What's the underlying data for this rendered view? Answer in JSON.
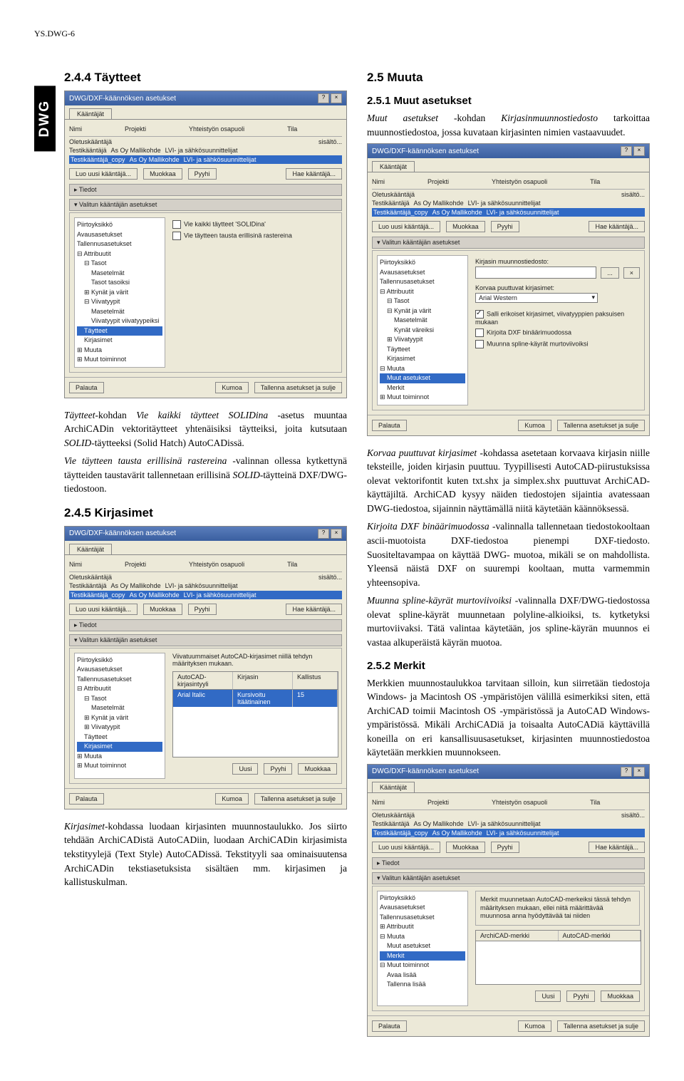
{
  "header_code": "YS.DWG-6",
  "side_tag": "DWG",
  "left": {
    "h1": "2.4.4 Täytteet",
    "p1_html": "<em>Täytteet</em>-kohdan <em>Vie kaikki täytteet SOLIDina</em> -asetus muuntaa ArchiCADin vektoritäytteet yhtenäisiksi täytteiksi, joita kutsutaan <em>SOLID</em>-täytteeksi (Solid Hatch) AutoCADissä.",
    "p2_html": "<em>Vie täytteen tausta erillisinä rastereina</em> -valinnan ollessa kytkettynä täytteiden taustavärit tallennetaan erillisinä <em>SOLID</em>-täytteinä DXF/DWG-tiedostoon.",
    "h2": "2.4.5 Kirjasimet",
    "p3_html": "<em>Kirjasimet</em>-kohdassa luodaan kirjasinten muunnostaulukko. Jos siirto tehdään ArchiCADistä AutoCADiin, luodaan ArchiCADin kirjasimista tekstityylejä (Text Style) AutoCADissä. Tekstityyli saa ominaisuutensa ArchiCADin tekstiasetuksista sisältäen mm. kirjasimen ja kallistuskulman."
  },
  "right": {
    "h1": "2.5 Muuta",
    "h2": "2.5.1 Muut asetukset",
    "p1_html": "<em>Muut asetukset</em> -kohdan <em>Kirjasinmuunnostiedosto</em> tarkoittaa muunnostiedostoa, jossa kuvataan kirjasinten nimien vastaavuudet.",
    "p2_html": "<em>Korvaa puuttuvat kirjasimet</em> -kohdassa asetetaan korvaava kirjasin niille teksteille, joiden kirjasin puuttuu. Tyypillisesti AutoCAD-piirustuksissa olevat vektorifontit kuten txt.shx ja simplex.shx puuttuvat ArchiCAD-käyttäjiltä. ArchiCAD kysyy näiden tiedostojen sijaintia avatessaan DWG-tiedostoa, sijainnin näyttämällä niitä käytetään käännöksessä.",
    "p3_html": "<em>Kirjoita DXF binäärimuodossa</em> -valinnalla tallennetaan tiedostokooltaan ascii-muotoista DXF-tiedostoa pienempi DXF-tiedosto. Suositeltavampaa on käyttää DWG- muotoa, mikäli se on mahdollista. Yleensä näistä DXF on suurempi kooltaan, mutta varmemmin yhteensopiva.",
    "p4_html": "<em>Muunna spline-käyrät murtoviivoiksi</em> -valinnalla DXF/DWG-tiedostossa olevat spline-käyrät muunnetaan polyline-alkioiksi, ts. kytketyksi murtoviivaksi. Tätä valintaa käytetään, jos spline-käyrän muunnos ei vastaa alkuperäistä käyrän muotoa.",
    "h3": "2.5.2 Merkit",
    "p5_html": "Merkkien muunnostaulukkoa tarvitaan silloin, kun siirretään tiedostoja Windows- ja Macintosh OS -ympäristöjen välillä esimerkiksi siten, että ArchiCAD toimii Macintosh OS -ympäristössä ja AutoCAD Windows-ympäristössä. Mikäli ArchiCADiä ja toisaalta AutoCADiä käyttävillä koneilla on eri kansallisuusasetukset, kirjasinten muunnostiedostoa käytetään merkkien muunnokseen."
  },
  "ui": {
    "dlg_title": "DWG/DXF-käännöksen asetukset",
    "tab_kaantajat": "Kääntäjät",
    "col_nimi": "Nimi",
    "col_projekti": "Projekti",
    "col_yht": "Yhteistyön osapuoli",
    "col_tila": "Tila",
    "oletus": "Oletuskääntäjä",
    "testik": "Testikääntäjä",
    "testik_copy": "Testikääntäjä_copy",
    "asoy": "As Oy Mallikohde",
    "lvi": "LVI- ja sähkösuunnittelijat",
    "sisalto": "sisältö...",
    "btn_luo": "Luo uusi kääntäjä...",
    "btn_muokkaa": "Muokkaa",
    "btn_pyyhi": "Pyyhi",
    "btn_hae": "Hae kääntäjä...",
    "sec_tiedot": "Tiedot",
    "sec_valitun": "Valitun kääntäjän asetukset",
    "tree": {
      "piirtoyksikko": "Piirtoyksikkö",
      "avausasetukset": "Avausasetukset",
      "tallennus": "Tallennusasetukset",
      "attribuutit": "Attribuutit",
      "tasot": "Tasot",
      "masetelmat": "Masetelmät",
      "tasot_tasoiksi": "Tasot tasoiksi",
      "kynat_varit": "Kynät ja värit",
      "kynat_vareiksi": "Kynät väreiksi",
      "viivatyypit": "Viivatyypit",
      "viivatyypit_vt": "Viivatyypit viivatyypeiksi",
      "taytteet": "Täytteet",
      "kirjasimet": "Kirjasimet",
      "muuta": "Muuta",
      "muut_asetukset": "Muut asetukset",
      "merkit": "Merkit",
      "muut_toiminnot": "Muut toiminnot",
      "avaa_lisaa": "Avaa lisää",
      "tallenna_lisaa": "Tallenna lisää"
    },
    "chk_vie_kaikki": "Vie kaikki täytteet 'SOLIDina'",
    "chk_vie_tausta": "Vie täytteen tausta erillisinä rastereina",
    "list_head_style": "AutoCAD-kirjasintyyli",
    "list_head_font": "Kirjasin",
    "list_head_kall": "Kallistus",
    "list_row_style": "Arial Italic",
    "list_row_font": "Kursivoitu Itäätinainen",
    "list_row_kall": "15",
    "rb_viiva_text": "Viivatuummaiset AutoCAD-kirjasimet niillä tehdyn määrityksen mukaan.",
    "btn_uusi": "Uusi",
    "btn_palauta": "Palauta",
    "btn_kumoa": "Kumoa",
    "btn_tallenna": "Tallenna asetukset ja sulje",
    "lbl_kirjasin_tiedosto": "Kirjasin muunnostiedosto:",
    "lbl_korvaa": "Korvaa puuttuvat kirjasimet:",
    "sel_arial": "Arial Western",
    "chk_salli": "Salli erikoiset kirjasimet, viivatyyppien paksuisen mukaan",
    "chk_kirjoita": "Kirjoita DXF binäärimuodossa",
    "chk_muunna": "Muunna spline-käyrät murtoviivoiksi",
    "merkit_para": "Merkit muunnetaan AutoCAD-merkeiksi tässä tehdyn määrityksen mukaan, ellei niitä määrittävää muunnosa anna hyödyttävää tai niiden",
    "archicad_merkki": "ArchiCAD-merkki",
    "autocad_merkki": "AutoCAD-merkki",
    "muuta_item": "Muuta"
  }
}
